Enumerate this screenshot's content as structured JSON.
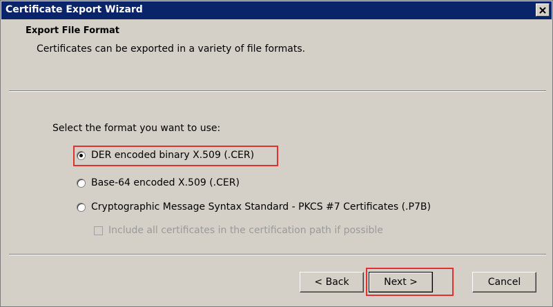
{
  "window": {
    "title": "Certificate Export Wizard",
    "close_glyph": "×"
  },
  "header": {
    "title": "Export File Format",
    "description": "Certificates can be exported in a variety of file formats."
  },
  "body": {
    "prompt": "Select the format you want to use:",
    "options": [
      {
        "label": "DER encoded binary X.509 (.CER)",
        "checked": true
      },
      {
        "label": "Base-64 encoded X.509 (.CER)",
        "checked": false
      },
      {
        "label": "Cryptographic Message Syntax Standard - PKCS #7 Certificates (.P7B)",
        "checked": false
      }
    ],
    "include_all_checkbox": {
      "label": "Include all certificates in the certification path if possible",
      "checked": false,
      "enabled": false
    }
  },
  "buttons": {
    "back": "< Back",
    "next": "Next >",
    "cancel": "Cancel"
  },
  "colors": {
    "titlebar": "#0a246a",
    "dialog_bg": "#d4d0c8",
    "highlight": "#e03030"
  }
}
